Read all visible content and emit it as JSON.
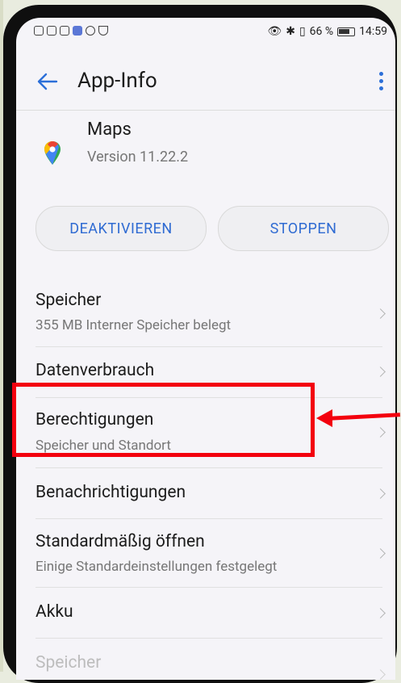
{
  "status_bar": {
    "battery_percent": "66 %",
    "time": "14:59"
  },
  "app_bar": {
    "title": "App-Info"
  },
  "app_info": {
    "name": "Maps",
    "version": "Version 11.22.2"
  },
  "buttons": {
    "disable": "DEAKTIVIEREN",
    "stop": "STOPPEN"
  },
  "list": [
    {
      "title": "Speicher",
      "subtitle": "355 MB Interner Speicher belegt"
    },
    {
      "title": "Datenverbrauch",
      "subtitle": ""
    },
    {
      "title": "Berechtigungen",
      "subtitle": "Speicher und Standort"
    },
    {
      "title": "Benachrichtigungen",
      "subtitle": ""
    },
    {
      "title": "Standardmäßig öffnen",
      "subtitle": "Einige Standardeinstellungen festgelegt"
    },
    {
      "title": "Akku",
      "subtitle": ""
    },
    {
      "title": "Speicher",
      "subtitle": ""
    }
  ],
  "colors": {
    "accent": "#2f6bd2",
    "highlight": "#f3000e"
  }
}
